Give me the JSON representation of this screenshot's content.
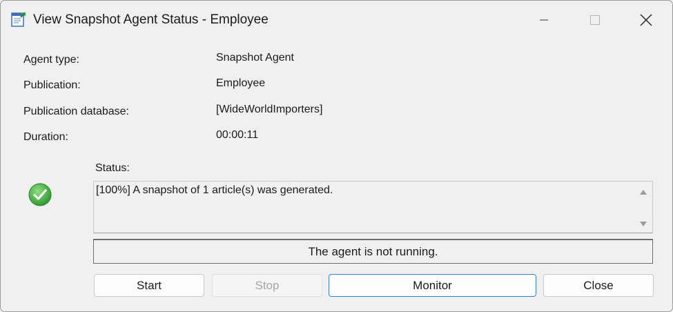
{
  "window": {
    "title": "View Snapshot Agent Status - Employee",
    "controls": {
      "minimize": "minimize-icon",
      "maximize": "maximize-icon",
      "close": "close-icon"
    }
  },
  "fields": [
    {
      "label": "Agent type:",
      "value": "Snapshot Agent"
    },
    {
      "label": "Publication:",
      "value": "Employee"
    },
    {
      "label": "Publication database:",
      "value": "[WideWorldImporters]"
    },
    {
      "label": "Duration:",
      "value": "00:00:11"
    }
  ],
  "status": {
    "label": "Status:",
    "icon": "success-check-icon",
    "message": "[100%] A snapshot of 1 article(s) was generated.",
    "agent_state": "The agent is not running."
  },
  "buttons": {
    "start": "Start",
    "stop": "Stop",
    "monitor": "Monitor",
    "close": "Close"
  },
  "colors": {
    "background": "#f0f0f0",
    "focus_border": "#3d7ecf",
    "success": "#3aa93a",
    "disabled_text": "#a6a6a6"
  }
}
